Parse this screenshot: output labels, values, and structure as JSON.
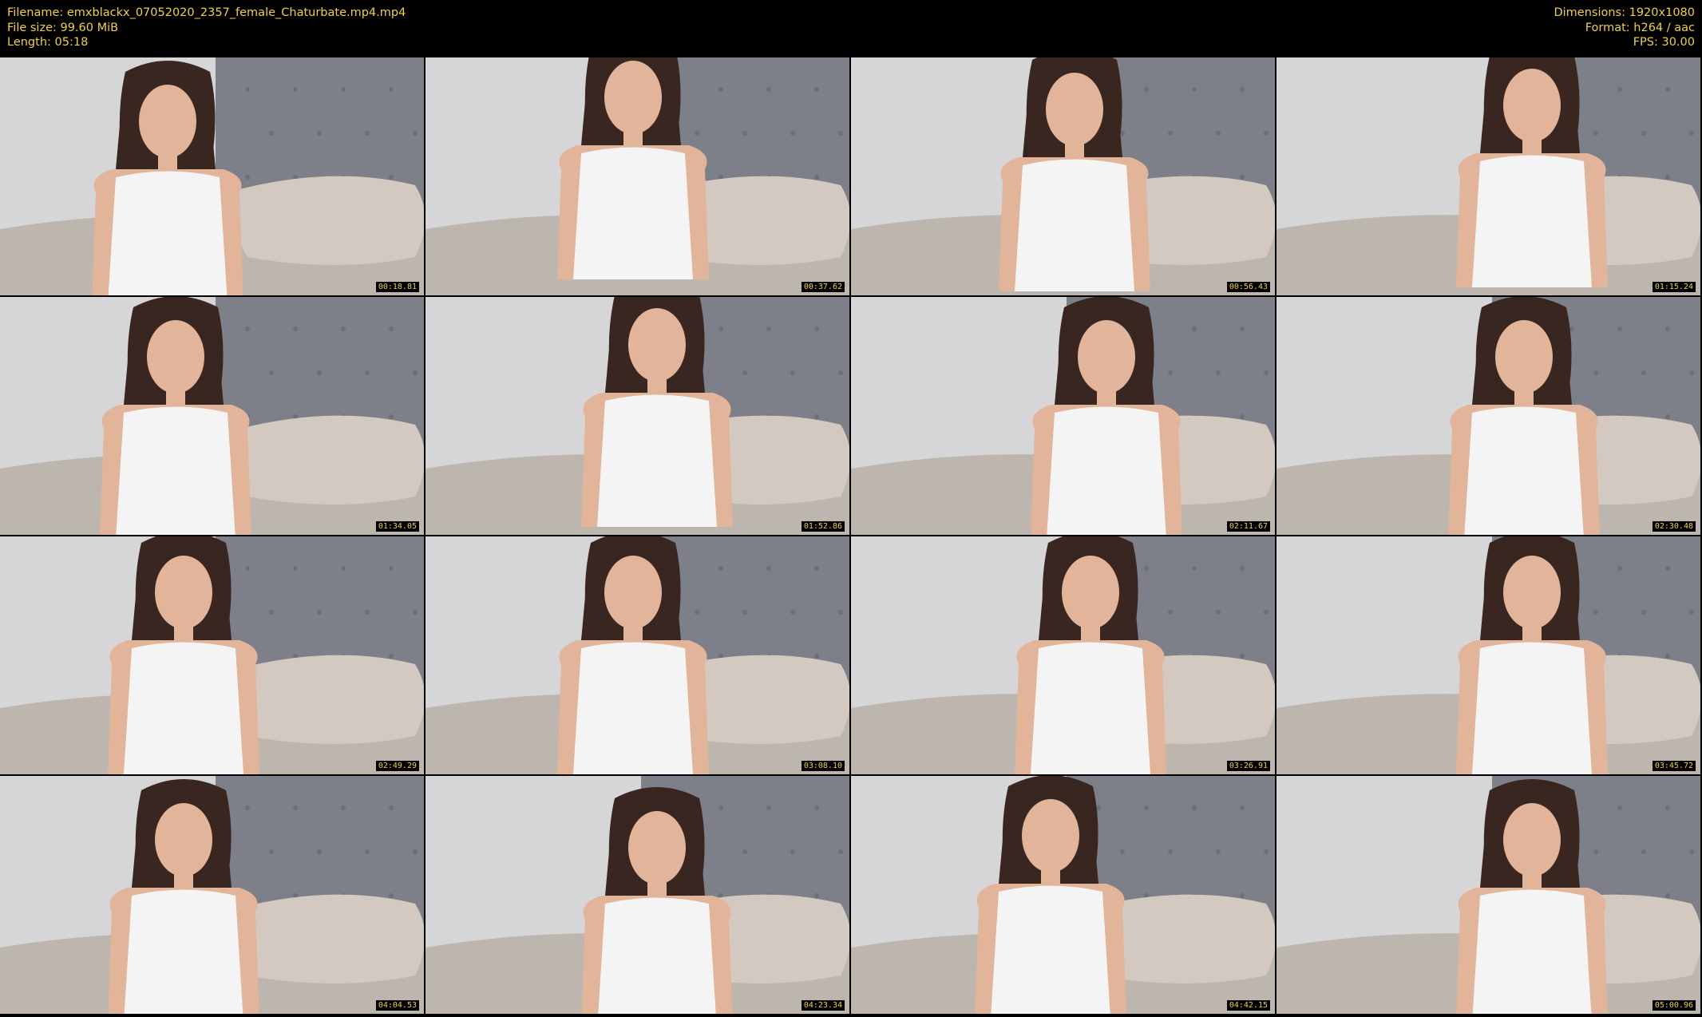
{
  "header": {
    "filename": "Filename: emxblackx_07052020_2357_female_Chaturbate.mp4.mp4",
    "filesize": "File size: 99.60 MiB",
    "length": "Length: 05:18",
    "dimensions": "Dimensions: 1920x1080",
    "format": "Format: h264 / aac",
    "fps": "FPS: 30.00"
  },
  "thumbnails": [
    {
      "timestamp": "00:18.81"
    },
    {
      "timestamp": "00:37.62"
    },
    {
      "timestamp": "00:56.43"
    },
    {
      "timestamp": "01:15.24"
    },
    {
      "timestamp": "01:34.05"
    },
    {
      "timestamp": "01:52.86"
    },
    {
      "timestamp": "02:11.67"
    },
    {
      "timestamp": "02:30.48"
    },
    {
      "timestamp": "02:49.29"
    },
    {
      "timestamp": "03:08.10"
    },
    {
      "timestamp": "03:26.91"
    },
    {
      "timestamp": "03:45.72"
    },
    {
      "timestamp": "04:04.53"
    },
    {
      "timestamp": "04:23.34"
    },
    {
      "timestamp": "04:42.15"
    },
    {
      "timestamp": "05:00.96"
    }
  ],
  "colors": {
    "header_text": "#f0d04a",
    "background": "#000000",
    "wall": "#d6d6d8",
    "headboard": "#7d8088",
    "pillow": "#d3c9c0",
    "bedsheet": "#bdb6ae",
    "top": "#f4f4f4",
    "skin": "#e2b49a",
    "hair": "#3a2620"
  }
}
